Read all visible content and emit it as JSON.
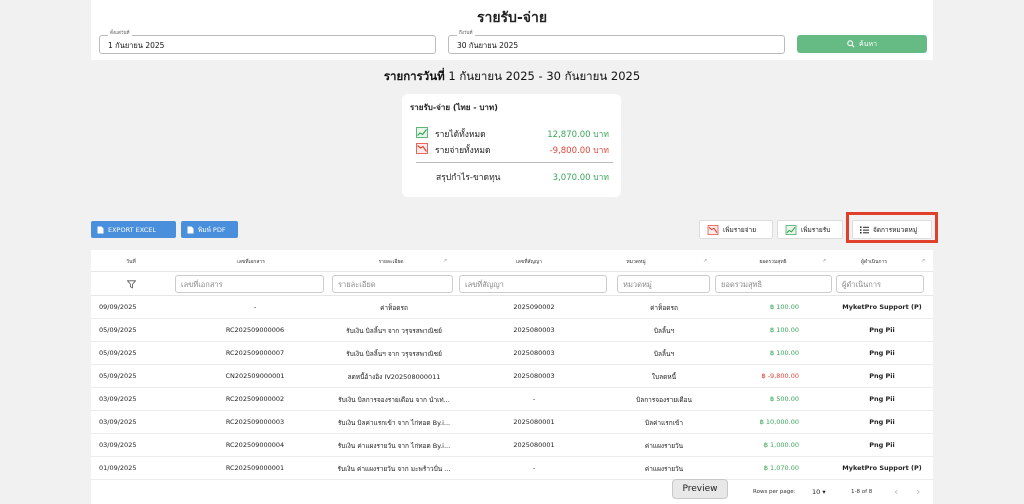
{
  "header": {
    "title": "รายรับ-จ่าย",
    "start_label": "ตั้งแต่วันที่",
    "start_value": "1 กันยายน 2025",
    "end_label": "ถึงวันที่",
    "end_value": "30 กันยายน 2025",
    "search_label": "ค้นหา"
  },
  "range": {
    "prefix": "รายการวันที่",
    "dates": "1 กันยายน 2025 - 30 กันยายน 2025"
  },
  "summary": {
    "title": "รายรับ-จ่าย (ไทย - บาท)",
    "income_label": "รายได้ทั้งหมด",
    "income_value": "12,870.00 บาท",
    "expense_label": "รายจ่ายทั้งหมด",
    "expense_value": "-9,800.00 บาท",
    "profit_label": "สรุปกำไร-ขาดทุน",
    "profit_value": "3,070.00 บาท"
  },
  "actions": {
    "export_excel": "EXPORT EXCEL",
    "print_pdf": "พิมพ์ PDF",
    "add_expense": "เพิ่มรายจ่าย",
    "add_income": "เพิ่มรายรับ",
    "manage_categories": "จัดการหมวดหมู่"
  },
  "table": {
    "headers": [
      "วันที่",
      "เลขที่เอกสาร",
      "รายละเอียด",
      "เลขที่สัญญา",
      "หมวดหมู่",
      "ยอดรวมสุทธิ",
      "ผู้ดำเนินการ"
    ],
    "filters": [
      "เลขที่เอกสาร",
      "รายละเอียด",
      "เลขที่สัญญา",
      "หมวดหมู่",
      "ยอดรวมสุทธิ",
      "ผู้ดำเนินการ"
    ],
    "rows": [
      {
        "date": "09/09/2025",
        "doc": "-",
        "detail": "ค่าท็อดรถ",
        "contract": "2025090002",
        "category": "ค่าท็อดรถ",
        "amount": "฿ 100.00",
        "amount_color": "#3aa55a",
        "by": "MyketPro Support (P)"
      },
      {
        "date": "05/09/2025",
        "doc": "RC202509000006",
        "detail": "รับเงิน บิลลิ้นฯ จาก วรุจรสพาณิชย์",
        "contract": "2025080003",
        "category": "บิลลิ้นฯ",
        "amount": "฿ 100.00",
        "amount_color": "#3aa55a",
        "by": "Png Pii"
      },
      {
        "date": "05/09/2025",
        "doc": "RC202509000007",
        "detail": "รับเงิน บิลลิ้นฯ จาก วรุจรสพาณิชย์",
        "contract": "2025080003",
        "category": "บิลลิ้นฯ",
        "amount": "฿ 100.00",
        "amount_color": "#3aa55a",
        "by": "Png Pii"
      },
      {
        "date": "05/09/2025",
        "doc": "CN202509000001",
        "detail": "ลดหนี้อ้างอิง IV202508000011",
        "contract": "2025080003",
        "category": "ใบลดหนี้",
        "amount": "฿ -9,800.00",
        "amount_color": "#e0453a",
        "by": "Png Pii"
      },
      {
        "date": "03/09/2025",
        "doc": "RC202509000002",
        "detail": "รับเงิน บิลการจองรายเดือน จาก นำเท่...",
        "contract": "-",
        "category": "บิลการจองรายเดือน",
        "amount": "฿ 500.00",
        "amount_color": "#3aa55a",
        "by": "Png Pii"
      },
      {
        "date": "03/09/2025",
        "doc": "RC202509000003",
        "detail": "รับเงิน บิลค่าแรกเข้า จาก ไก่ทอด By.i...",
        "contract": "2025080001",
        "category": "บิลค่าแรกเข้า",
        "amount": "฿ 10,000.00",
        "amount_color": "#3aa55a",
        "by": "Png Pii"
      },
      {
        "date": "03/09/2025",
        "doc": "RC202509000004",
        "detail": "รับเงิน ค่าแผงรายวัน จาก ไก่ทอด By.i...",
        "contract": "2025080001",
        "category": "ค่าแผงรายวัน",
        "amount": "฿ 1,000.00",
        "amount_color": "#3aa55a",
        "by": "Png Pii"
      },
      {
        "date": "01/09/2025",
        "doc": "RC202509000001",
        "detail": "รับเงิน ค่าแผงรายวัน จาก มะพร้าวปั่น ...",
        "contract": "-",
        "category": "ค่าแผงรายวัน",
        "amount": "฿ 1,070.00",
        "amount_color": "#3aa55a",
        "by": "MyketPro Support (P)"
      }
    ]
  },
  "footer": {
    "rows_per_page_label": "Rows per page:",
    "rows_per_page_value": "10",
    "range_label": "1-8 of 8"
  },
  "preview_label": "Preview"
}
